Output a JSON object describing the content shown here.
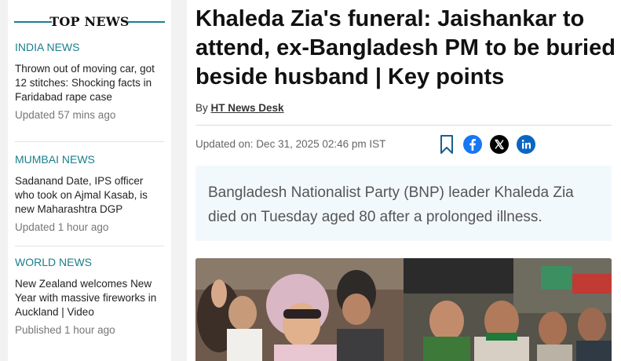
{
  "sidebar": {
    "title": "TOP NEWS",
    "sections": [
      {
        "category": "INDIA NEWS",
        "headline": "Thrown out of moving car, got 12 stitches: Shocking facts in Faridabad rape case",
        "time": "Updated 57 mins ago"
      },
      {
        "category": "MUMBAI NEWS",
        "headline": "Sadanand Date, IPS officer who took on Ajmal Kasab, is new Maharashtra DGP",
        "time": "Updated 1 hour ago"
      },
      {
        "category": "WORLD NEWS",
        "headline": "New Zealand welcomes New Year with massive fireworks in Auckland | Video",
        "time": "Published 1 hour ago"
      }
    ]
  },
  "article": {
    "headline": "Khaleda Zia's funeral: Jaishankar to attend, ex-Bangladesh PM to be buried beside husband | Key points",
    "by_label": "By",
    "author": "HT News Desk",
    "updated": "Updated on: Dec 31, 2025 02:46 pm IST",
    "summary": "Bangladesh Nationalist Party (BNP) leader Khaleda Zia died on Tuesday aged 80 after a prolonged illness."
  },
  "share_icons": [
    "bookmark-icon",
    "facebook-icon",
    "x-icon",
    "linkedin-icon"
  ],
  "colors": {
    "accent": "#1a7f8c",
    "facebook": "#1877f2",
    "x": "#000000",
    "linkedin": "#0a66c2",
    "summary_bg": "#f2f9fd"
  }
}
